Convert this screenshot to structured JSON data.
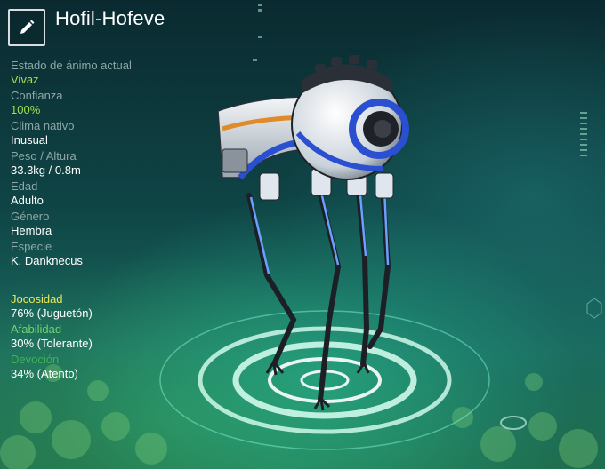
{
  "creature": {
    "name": "Hofil-Hofeve"
  },
  "icons": {
    "edit": "pencil-icon"
  },
  "stats": [
    {
      "label": "Estado de ánimo actual",
      "value": "Vivaz",
      "highlight": true
    },
    {
      "label": "Confianza",
      "value": "100%",
      "highlight": true
    },
    {
      "label": "Clima nativo",
      "value": "Inusual",
      "highlight": false
    },
    {
      "label": "Peso / Altura",
      "value": "33.3kg / 0.8m",
      "highlight": false
    },
    {
      "label": "Edad",
      "value": "Adulto",
      "highlight": false
    },
    {
      "label": "Género",
      "value": "Hembra",
      "highlight": false
    },
    {
      "label": "Especie",
      "value": "K. Danknecus",
      "highlight": false
    }
  ],
  "traits": [
    {
      "label": "Jocosidad",
      "value": "76% (Juguetón)",
      "color": "#e8e85a"
    },
    {
      "label": "Afabilidad",
      "value": "30% (Tolerante)",
      "color": "#6fd46f"
    },
    {
      "label": "Devoción",
      "value": "34% (Atento)",
      "color": "#3fb35a"
    }
  ],
  "colors": {
    "accent_green": "#9fe04a",
    "label_gray": "#8fa7a6",
    "robot_blue": "#2a4fd0",
    "robot_orange": "#e08a2a"
  }
}
